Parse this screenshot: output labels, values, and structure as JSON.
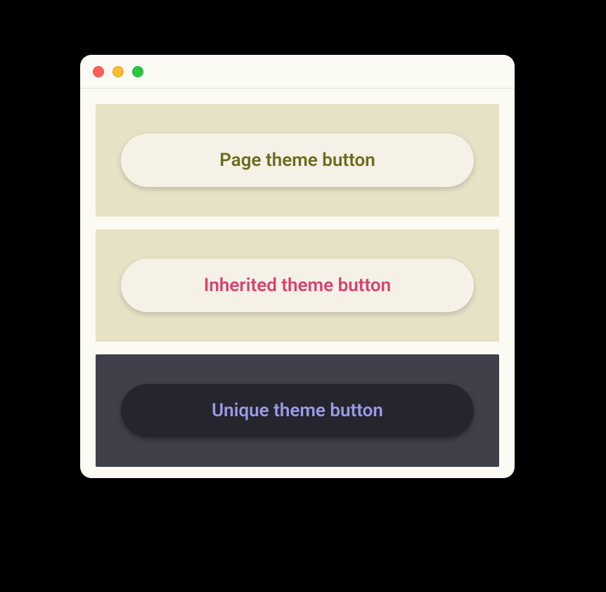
{
  "panels": [
    {
      "button_label": "Page theme button",
      "panel_bg": "#e7e1c6",
      "button_bg": "#f5f1e6",
      "text_color": "#6e6a1e"
    },
    {
      "button_label": "Inherited theme button",
      "panel_bg": "#e7e1c6",
      "button_bg": "#f5f1e6",
      "text_color": "#d94171"
    },
    {
      "button_label": "Unique theme button",
      "panel_bg": "#3f4049",
      "button_bg": "#24252d",
      "text_color": "#9a9ae6"
    }
  ]
}
